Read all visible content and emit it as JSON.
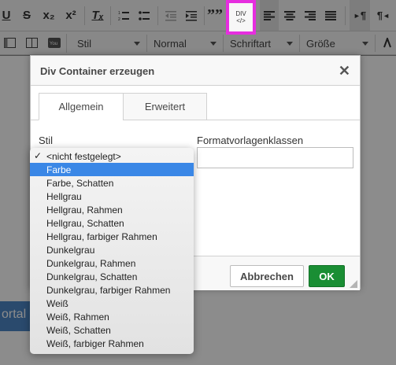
{
  "toolbar1": {
    "underline": "U",
    "strike": "S",
    "subscript": "x₂",
    "superscript": "x²",
    "clear_format": "Tₓ",
    "quote": "””",
    "div_label_top": "DIV",
    "div_label_bottom": "</>",
    "para_ltr": "¶",
    "para_rtl": "¶"
  },
  "toolbar2": {
    "style": "Stil",
    "format": "Normal",
    "font": "Schriftart",
    "size": "Größe"
  },
  "background": {
    "portal_button": "ortal a"
  },
  "dialog": {
    "title": "Div Container erzeugen",
    "close": "✕",
    "tabs": [
      "Allgemein",
      "Erweitert"
    ],
    "stil_label": "Stil",
    "formatklassen_label": "Formatvorlagenklassen",
    "cancel": "Abbrechen",
    "ok": "OK"
  },
  "dropdown": {
    "checkmark": "✓",
    "items": [
      "<nicht festgelegt>",
      "Farbe",
      "Farbe, Schatten",
      "Hellgrau",
      "Hellgrau, Rahmen",
      "Hellgrau, Schatten",
      "Hellgrau, farbiger Rahmen",
      "Dunkelgrau",
      "Dunkelgrau, Rahmen",
      "Dunkelgrau, Schatten",
      "Dunkelgrau, farbiger Rahmen",
      "Weiß",
      "Weiß, Rahmen",
      "Weiß, Schatten",
      "Weiß, farbiger Rahmen"
    ],
    "checked_index": 0,
    "highlighted_index": 1
  },
  "colors": {
    "highlight_box": "#e62edf",
    "ok_button": "#1a8e34",
    "selection": "#3a87e6"
  }
}
